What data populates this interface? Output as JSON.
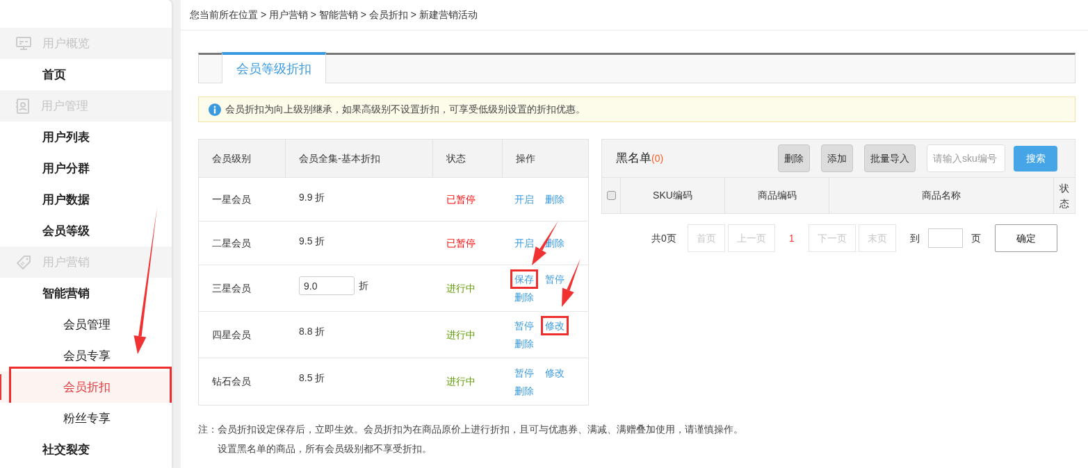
{
  "sidebar": {
    "groups": [
      {
        "title": "用户概览",
        "items": [
          {
            "label": "首页",
            "selected": false,
            "highlighted": false
          }
        ]
      },
      {
        "title": "用户管理",
        "items": [
          {
            "label": "用户列表",
            "selected": false,
            "highlighted": false
          },
          {
            "label": "用户分群",
            "selected": false,
            "highlighted": false
          },
          {
            "label": "用户数据",
            "selected": false,
            "highlighted": false
          },
          {
            "label": "会员等级",
            "selected": false,
            "highlighted": false
          }
        ]
      },
      {
        "title": "用户营销",
        "items": [
          {
            "label": "智能营销",
            "selected": false,
            "highlighted": false,
            "children": [
              {
                "label": "会员管理",
                "selected": false,
                "highlighted": false
              },
              {
                "label": "会员专享",
                "selected": false,
                "highlighted": false
              },
              {
                "label": "会员折扣",
                "selected": true,
                "highlighted": true
              },
              {
                "label": "粉丝专享",
                "selected": false,
                "highlighted": false
              }
            ]
          },
          {
            "label": "社交裂变",
            "selected": false,
            "highlighted": false
          }
        ]
      }
    ]
  },
  "breadcrumb": "您当前所在位置 > 用户营销 > 智能营销 > 会员折扣 > 新建营销活动",
  "tabs": [
    {
      "label": "会员等级折扣",
      "selected": true
    }
  ],
  "notice": "会员折扣为向上级别继承，如果高级别不设置折扣，可享受低级别设置的折扣优惠。",
  "level_table": {
    "columns": [
      "会员级别",
      "会员全集-基本折扣",
      "状态",
      "操作"
    ],
    "rows": [
      {
        "level": "一星会员",
        "discount": {
          "kind": "text",
          "value": "9.9 折"
        },
        "status": {
          "kind": "paused",
          "label": "已暂停"
        },
        "actions": [
          {
            "label": "开启",
            "highlighted": false
          },
          {
            "label": "删除",
            "highlighted": false
          }
        ]
      },
      {
        "level": "二星会员",
        "discount": {
          "kind": "text",
          "value": "9.5 折"
        },
        "status": {
          "kind": "paused",
          "label": "已暂停"
        },
        "actions": [
          {
            "label": "开启",
            "highlighted": false
          },
          {
            "label": "删除",
            "highlighted": false
          }
        ]
      },
      {
        "level": "三星会员",
        "discount": {
          "kind": "input",
          "value": "9.0",
          "unit": "折"
        },
        "status": {
          "kind": "running",
          "label": "进行中"
        },
        "actions": [
          {
            "label": "保存",
            "highlighted": true
          },
          {
            "label": "暂停",
            "highlighted": false
          },
          {
            "label": "删除",
            "highlighted": false
          }
        ]
      },
      {
        "level": "四星会员",
        "discount": {
          "kind": "text",
          "value": "8.8 折"
        },
        "status": {
          "kind": "running",
          "label": "进行中"
        },
        "actions": [
          {
            "label": "暂停",
            "highlighted": false
          },
          {
            "label": "修改",
            "highlighted": true
          },
          {
            "label": "删除",
            "highlighted": false
          }
        ]
      },
      {
        "level": "钻石会员",
        "discount": {
          "kind": "text",
          "value": "8.5 折"
        },
        "status": {
          "kind": "running",
          "label": "进行中"
        },
        "actions": [
          {
            "label": "暂停",
            "highlighted": false
          },
          {
            "label": "修改",
            "highlighted": false
          },
          {
            "label": "删除",
            "highlighted": false
          }
        ]
      }
    ]
  },
  "blacklist": {
    "title": "黑名单",
    "count": "(0)",
    "buttons": [
      "删除",
      "添加",
      "批量导入"
    ],
    "search": {
      "placeholder": "请输入sku编号",
      "button": "搜索"
    },
    "select_all": {
      "checked": false
    },
    "columns": [
      "SKU编码",
      "商品编码",
      "商品名称",
      "状态"
    ],
    "pagination": {
      "total": "共0页",
      "first": "首页",
      "prev": "上一页",
      "current": "1",
      "next": "下一页",
      "last": "末页",
      "goto": "到",
      "page": "页",
      "confirm": "确定"
    }
  },
  "notes": {
    "label": "注：",
    "lines": [
      "会员折扣设定保存后，立即生效。会员折扣为在商品原价上进行折扣，且可与优惠券、满减、满赠叠加使用，请谨慎操作。",
      "设置黑名单的商品，所有会员级别都不享受折扣。"
    ]
  }
}
